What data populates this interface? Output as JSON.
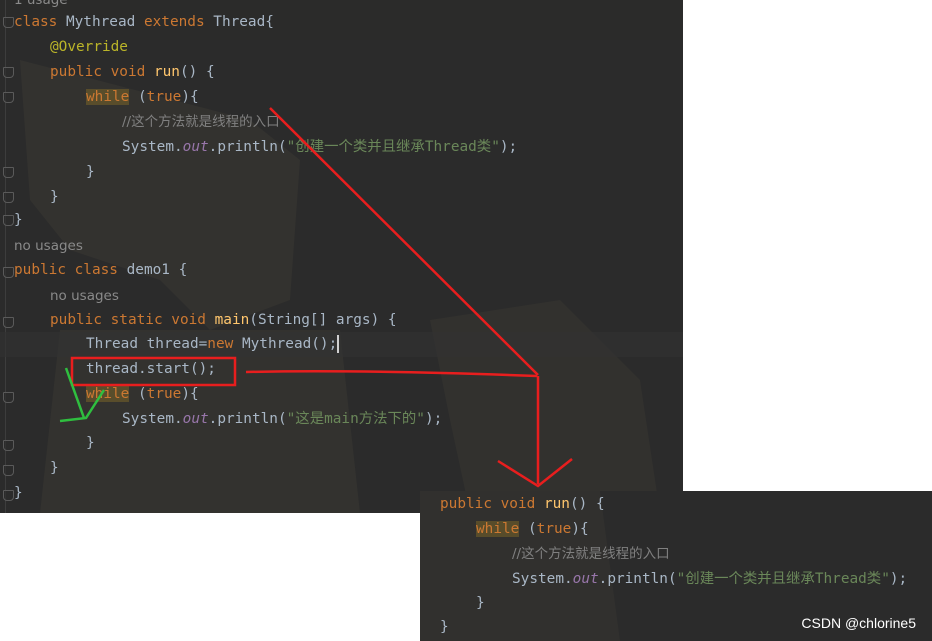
{
  "colors": {
    "editor_bg": "#2b2b2b",
    "keyword": "#cc7832",
    "function": "#ffc66d",
    "annotation": "#bbb529",
    "string": "#6a8759",
    "comment": "#808080",
    "field": "#9876aa",
    "plain": "#a9b7c6",
    "red_arrow": "#e81e1e",
    "green_arrow": "#2fbf3f"
  },
  "main_editor": {
    "top_hint": "1 usage",
    "line1": {
      "kw": "class ",
      "cls": "Mythread ",
      "kw2": "extends ",
      "parent": "Thread{"
    },
    "line2": {
      "annotation": "@Override"
    },
    "line3": {
      "kw": "public void ",
      "fn": "run",
      "rest": "() {"
    },
    "line4": {
      "kw": "while",
      "mid": " (",
      "kw2": "true",
      "rest": "){"
    },
    "line5": {
      "comment": "//这个方法就是线程的入口"
    },
    "line6": {
      "pre": "System.",
      "field": "out",
      "mid": ".println(",
      "str": "\"创建一个类并且继承Thread类\"",
      "end": ");"
    },
    "line7": "}",
    "line8": "}",
    "line9": "}",
    "hint1": "no usages",
    "line10": {
      "kw": "public class ",
      "rest": "demo1 {"
    },
    "hint2": "no usages",
    "line11": {
      "kw": "public static void ",
      "fn": "main",
      "rest": "(String[] args) {"
    },
    "line12": {
      "pre": "Thread thread=",
      "kw": "new",
      "rest": " Mythread();"
    },
    "line13": "thread.start();",
    "line14": {
      "kw": "while",
      "mid": " (",
      "kw2": "true",
      "rest": "){"
    },
    "line15": {
      "pre": "System.",
      "field": "out",
      "mid": ".println(",
      "str": "\"这是main方法下的\"",
      "end": ");"
    },
    "line16": "}",
    "line17": "}",
    "line18": "}"
  },
  "snippet_editor": {
    "line1": {
      "kw": "public void ",
      "fn": "run",
      "rest": "() {"
    },
    "line2": {
      "kw": "while",
      "mid": " (",
      "kw2": "true",
      "rest": "){"
    },
    "line3": {
      "comment": "//这个方法就是线程的入口"
    },
    "line4": {
      "pre": "System.",
      "field": "out",
      "mid": ".println(",
      "str": "\"创建一个类并且继承Thread类\"",
      "end": ");"
    },
    "line5": "}",
    "line6": "}"
  },
  "watermark": "CSDN @chlorine5"
}
